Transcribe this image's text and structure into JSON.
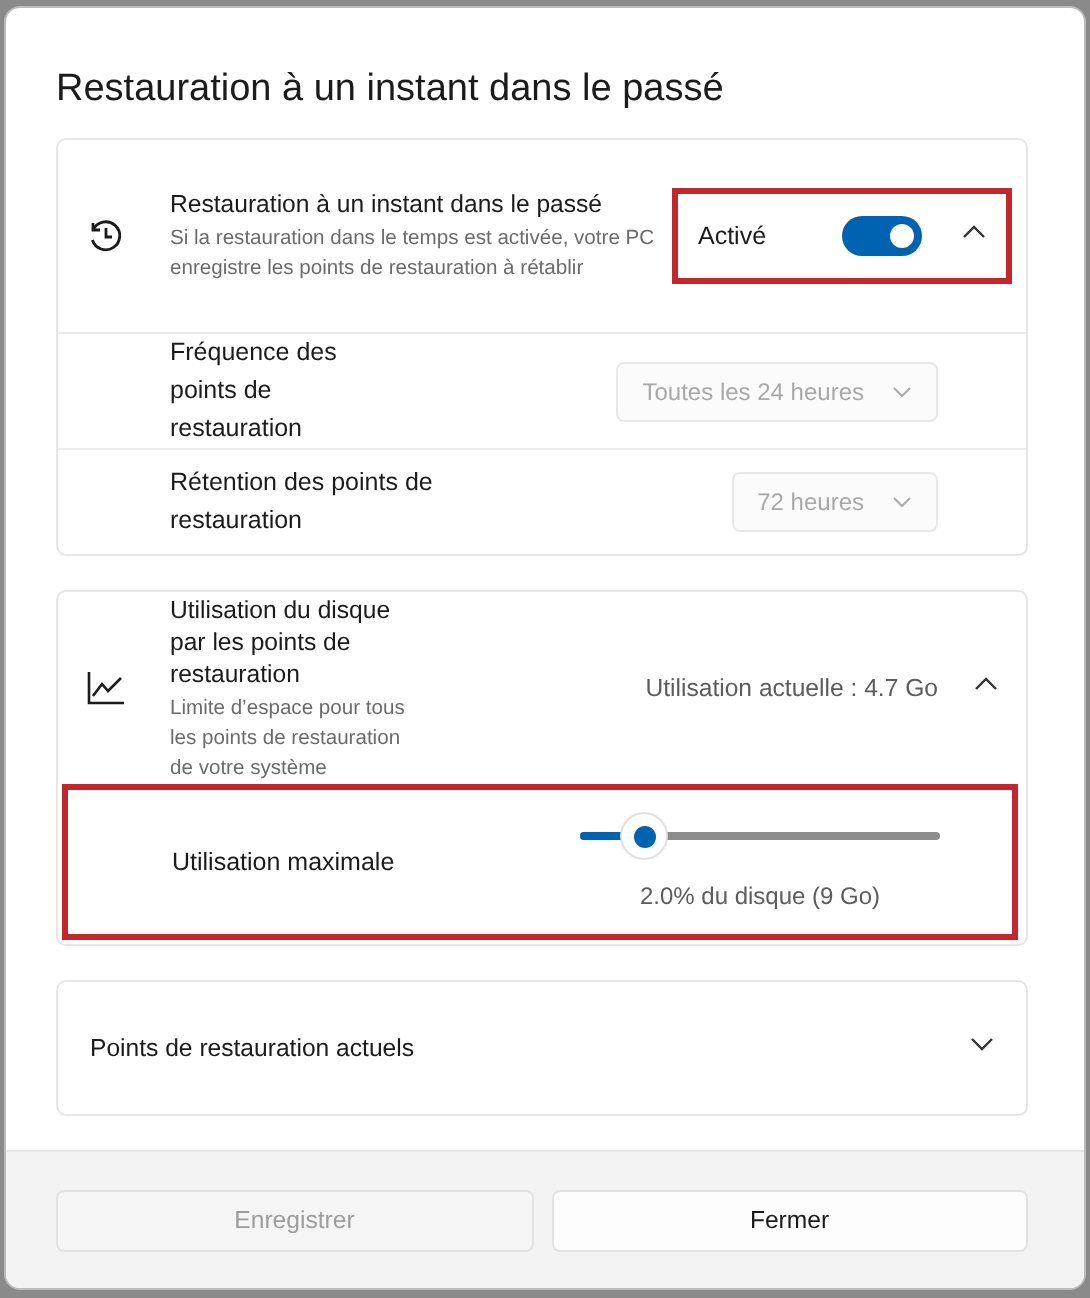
{
  "dialog": {
    "title": "Restauration à un instant dans le passé"
  },
  "restore_card": {
    "title": "Restauration à un instant dans le passé",
    "description": "Si la restauration dans le temps est activée, votre PC enregistre les points de restauration à rétablir",
    "status": "Activé",
    "on": true,
    "expanded": true,
    "highlighted": true,
    "settings": [
      {
        "label": "Fréquence des points de restauration",
        "value": "Toutes les 24 heures",
        "disabled": true
      },
      {
        "label": "Rétention des points de restauration",
        "value": "72 heures",
        "disabled": true
      }
    ]
  },
  "disk_card": {
    "title": "Utilisation du disque par les points de restauration",
    "description": "Limite d’espace pour tous les points de restauration de votre système",
    "usage": "Utilisation actuelle : 4.7 Go",
    "expanded": true,
    "slider": {
      "label": "Utilisation maximale",
      "level": 0.18,
      "reading": "2.0% du disque (9 Go)",
      "highlighted": true
    }
  },
  "points_card": {
    "title": "Points de restauration actuels",
    "expanded": false
  },
  "buttons": [
    {
      "label": "Enregistrer",
      "disabled": true
    },
    {
      "label": "Fermer",
      "disabled": false
    }
  ]
}
